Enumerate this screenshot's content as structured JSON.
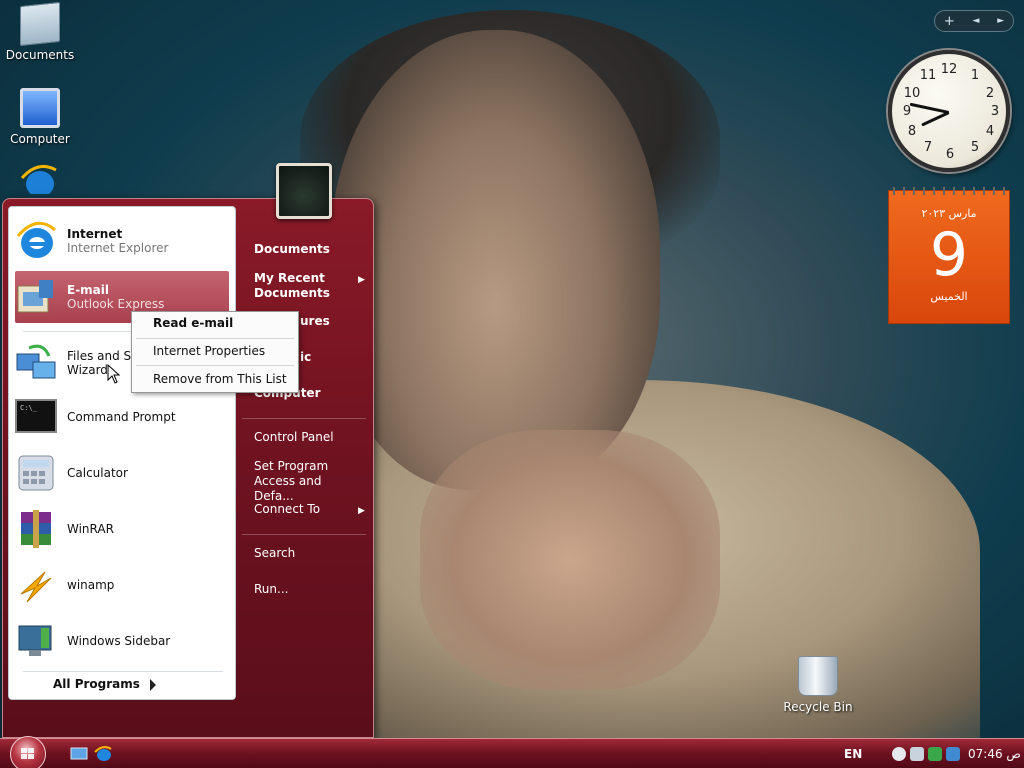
{
  "desktop": {
    "icons": [
      {
        "label": "Documents"
      },
      {
        "label": "Computer"
      },
      {
        "label": "Recycle Bin"
      }
    ]
  },
  "gadgets": {
    "toolbar": {
      "add": "+",
      "prev": "◄",
      "next": "►"
    },
    "clock": {
      "numbers": [
        "12",
        "1",
        "2",
        "3",
        "4",
        "5",
        "6",
        "7",
        "8",
        "9",
        "10",
        "11"
      ]
    },
    "calendar": {
      "month": "مارس ٢٠٢٣",
      "day": "9",
      "weekday": "الخميس"
    }
  },
  "start_menu": {
    "pinned": [
      {
        "title": "Internet",
        "subtitle": "Internet Explorer"
      },
      {
        "title": "E-mail",
        "subtitle": "Outlook Express"
      }
    ],
    "recent": [
      {
        "title": "Files and Set",
        "subtitle": "Wizard"
      },
      {
        "title": "Command Prompt"
      },
      {
        "title": "Calculator"
      },
      {
        "title": "WinRAR"
      },
      {
        "title": "winamp"
      },
      {
        "title": "Windows Sidebar"
      }
    ],
    "all_programs": "All Programs",
    "right": [
      {
        "label": "Documents"
      },
      {
        "label": "My Recent Documents"
      },
      {
        "label": "ures"
      },
      {
        "label": "ic"
      },
      {
        "label": "Computer"
      },
      {
        "label": "Control Panel"
      },
      {
        "label": "Set Program Access and Defa..."
      },
      {
        "label": "Connect To"
      },
      {
        "label": "Search"
      },
      {
        "label": "Run..."
      }
    ]
  },
  "context_menu": {
    "items": [
      {
        "label": "Read e-mail"
      },
      {
        "label": "Internet Properties"
      },
      {
        "label": "Remove from This List"
      }
    ]
  },
  "taskbar": {
    "language": "EN",
    "time": "07:46 ص"
  }
}
